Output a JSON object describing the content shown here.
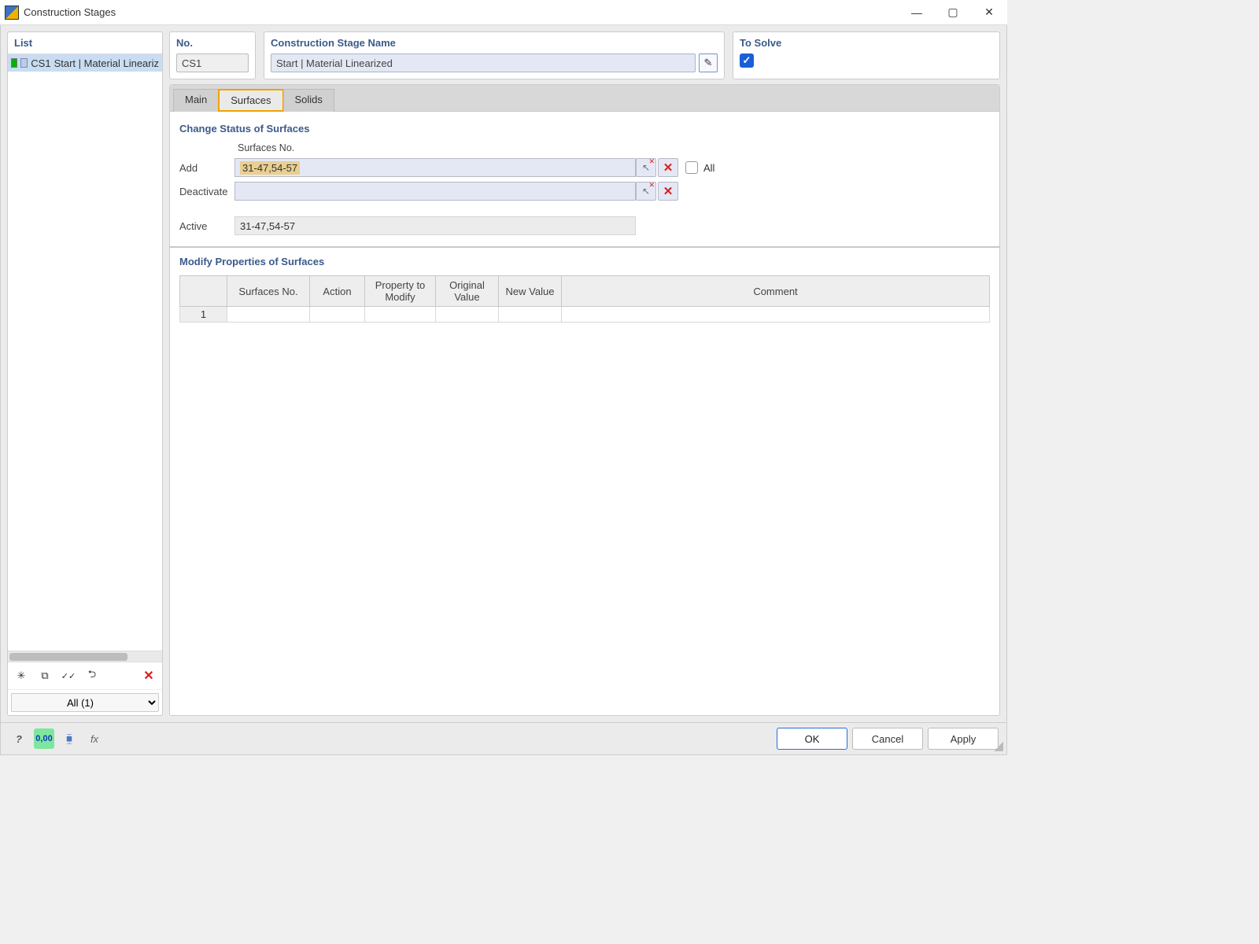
{
  "window": {
    "title": "Construction Stages",
    "minimize_tooltip": "Minimize",
    "maximize_tooltip": "Maximize",
    "close_tooltip": "Close"
  },
  "left": {
    "header": "List",
    "items": [
      {
        "code": "CS1",
        "label": "Start | Material Lineariz"
      }
    ],
    "toolbar": {
      "new": "New",
      "copy": "Copy",
      "checkall": "Check All",
      "uncheckall": "Uncheck All",
      "delete": "Delete"
    },
    "filter_value": "All (1)"
  },
  "header_fields": {
    "no_label": "No.",
    "no_value": "CS1",
    "name_label": "Construction Stage Name",
    "name_value": "Start | Material Linearized",
    "solve_label": "To Solve",
    "solve_checked": true
  },
  "tabs": {
    "main": "Main",
    "surfaces": "Surfaces",
    "solids": "Solids",
    "active": "surfaces"
  },
  "surfaces_tab": {
    "section_change": "Change Status of Surfaces",
    "col_surfaces_no": "Surfaces No.",
    "row_add": "Add",
    "row_deactivate": "Deactivate",
    "row_active": "Active",
    "add_value": "31-47,54-57",
    "deactivate_value": "",
    "active_value": "31-47,54-57",
    "all_label": "All",
    "section_modify": "Modify Properties of Surfaces",
    "mod_table": {
      "headers": {
        "surfaces_no": "Surfaces No.",
        "action": "Action",
        "property": "Property to Modify",
        "original": "Original Value",
        "new": "New Value",
        "comment": "Comment"
      },
      "rows": [
        {
          "n": "1",
          "surfaces_no": "",
          "action": "",
          "property": "",
          "original": "",
          "new": "",
          "comment": ""
        }
      ]
    }
  },
  "bottom": {
    "help": "Help",
    "units": "Units",
    "filters": "Filters",
    "fx": "Formula",
    "ok": "OK",
    "cancel": "Cancel",
    "apply": "Apply"
  }
}
